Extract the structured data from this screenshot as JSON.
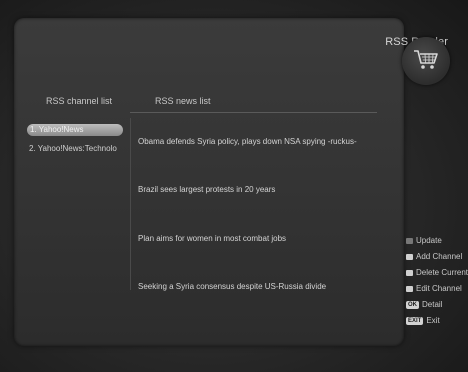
{
  "header": {
    "title": "RSS Reader",
    "cart_icon": "shopping-cart-icon"
  },
  "columns": {
    "channels": "RSS channel list",
    "news": "RSS news list"
  },
  "channels": [
    {
      "label": "1. Yahoo!News"
    },
    {
      "label": "2. Yahoo!News:Technolo"
    }
  ],
  "news": [
    {
      "headline": "Obama defends Syria policy, plays down NSA spying -ruckus-"
    },
    {
      "headline": "Brazil sees largest protests in 20 years"
    },
    {
      "headline": "Plan aims for women in most combat jobs"
    },
    {
      "headline": "Seeking a Syria consensus despite US-Russia divide"
    }
  ],
  "legend": {
    "update": "Update",
    "add_channel": "Add Channel",
    "delete_current": "Delete Current",
    "edit_channel": "Edit Channel",
    "ok_key": "OK",
    "detail": "Detail",
    "exit_key": "EXIT",
    "exit": "Exit"
  }
}
